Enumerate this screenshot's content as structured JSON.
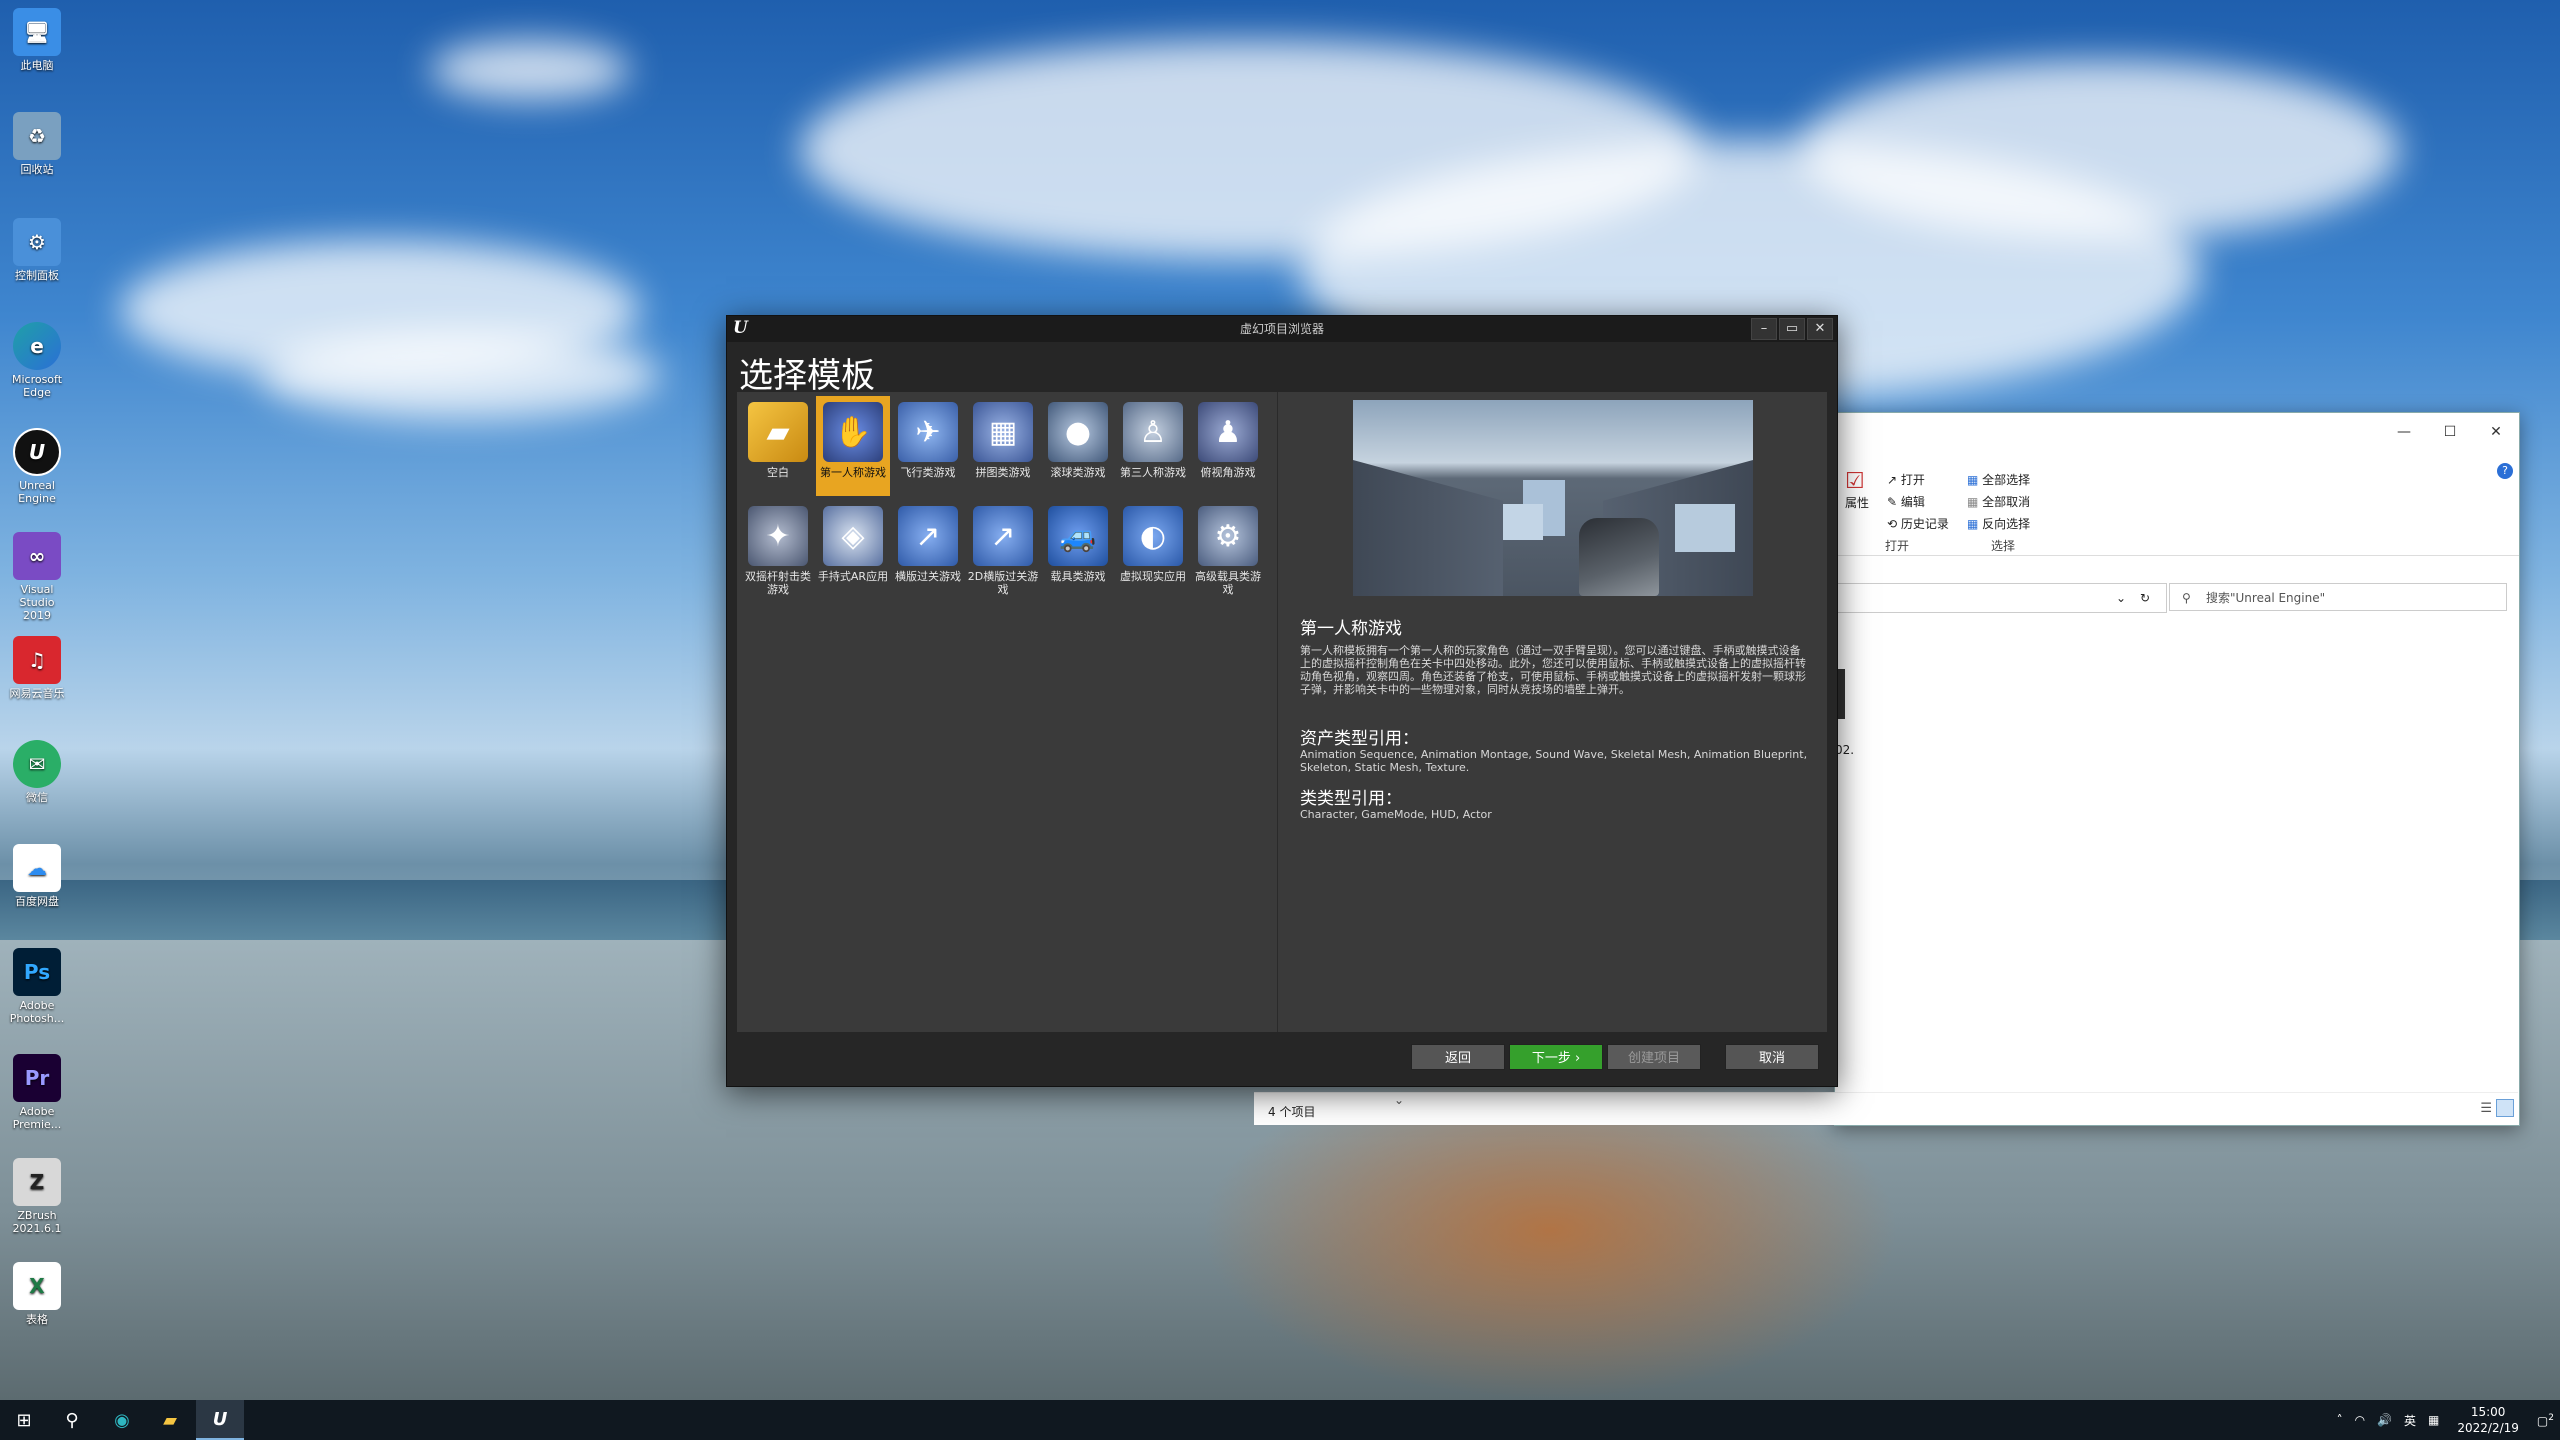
{
  "desktop": {
    "icons": [
      {
        "label": "此电脑",
        "icon": "computer-icon",
        "color": "#3a8ee6"
      },
      {
        "label": "回收站",
        "icon": "recycle-bin-icon",
        "color": "#7aa0c0"
      },
      {
        "label": "控制面板",
        "icon": "control-panel-icon",
        "color": "#4a90d9"
      },
      {
        "label": "Microsoft Edge",
        "icon": "edge-icon",
        "color": "#1fa0a8"
      },
      {
        "label": "Unreal Engine",
        "icon": "unreal-icon",
        "color": "#111111"
      },
      {
        "label": "Visual Studio 2019",
        "icon": "visual-studio-icon",
        "color": "#7a4bc4"
      },
      {
        "label": "网易云音乐",
        "icon": "netease-music-icon",
        "color": "#d9272e"
      },
      {
        "label": "微信",
        "icon": "wechat-icon",
        "color": "#2aae67"
      },
      {
        "label": "百度网盘",
        "icon": "baidu-netdisk-icon",
        "color": "#ffffff"
      },
      {
        "label": "Adobe Photosh...",
        "icon": "photoshop-icon",
        "color": "#001e36"
      },
      {
        "label": "Adobe Premie...",
        "icon": "premiere-icon",
        "color": "#1a0033"
      },
      {
        "label": "ZBrush 2021.6.1",
        "icon": "zbrush-icon",
        "color": "#d8d8d8"
      },
      {
        "label": "表格",
        "icon": "excel-icon",
        "color": "#ffffff"
      }
    ]
  },
  "ue_dialog": {
    "window_title": "虚幻项目浏览器",
    "heading": "选择模板",
    "templates": [
      {
        "label": "空白",
        "icon": "folder-icon",
        "color": "#d9a520"
      },
      {
        "label": "第一人称游戏",
        "icon": "first-person-icon",
        "color": "#4b6fd6",
        "selected": true
      },
      {
        "label": "飞行类游戏",
        "icon": "flying-icon",
        "color": "#5b8fe0"
      },
      {
        "label": "拼图类游戏",
        "icon": "puzzle-icon",
        "color": "#6a8cd8"
      },
      {
        "label": "滚球类游戏",
        "icon": "rolling-ball-icon",
        "color": "#7c9ec4"
      },
      {
        "label": "第三人称游戏",
        "icon": "third-person-icon",
        "color": "#8aa2c2"
      },
      {
        "label": "俯视角游戏",
        "icon": "top-down-icon",
        "color": "#6b7fb0"
      },
      {
        "label": "双摇杆射击类游戏",
        "icon": "twin-stick-icon",
        "color": "#7e8aa6"
      },
      {
        "label": "手持式AR应用",
        "icon": "handheld-ar-icon",
        "color": "#a7b8d6"
      },
      {
        "label": "横版过关游戏",
        "icon": "side-scroller-icon",
        "color": "#5d8fd9"
      },
      {
        "label": "2D横版过关游戏",
        "icon": "2d-side-scroller-icon",
        "color": "#5d8fd9"
      },
      {
        "label": "载具类游戏",
        "icon": "vehicle-icon",
        "color": "#3f7bd4"
      },
      {
        "label": "虚拟现实应用",
        "icon": "vr-icon",
        "color": "#4a84d9"
      },
      {
        "label": "高级载具类游戏",
        "icon": "advanced-vehicle-icon",
        "color": "#8ba4c4"
      }
    ],
    "selected_title": "第一人称游戏",
    "selected_description": "第一人称模板拥有一个第一人称的玩家角色（通过一双手臂呈现）。您可以通过键盘、手柄或触摸式设备上的虚拟摇杆控制角色在关卡中四处移动。此外，您还可以使用鼠标、手柄或触摸式设备上的虚拟摇杆转动角色视角，观察四周。角色还装备了枪支，可使用鼠标、手柄或触摸式设备上的虚拟摇杆发射一颗球形子弹，并影响关卡中的一些物理对象，同时从竞技场的墙壁上弹开。",
    "asset_refs_title": "资产类型引用：",
    "asset_refs": "Animation Sequence, Animation Montage, Sound Wave, Skeletal Mesh, Animation Blueprint, Skeleton, Static Mesh, Texture.",
    "class_refs_title": "类类型引用：",
    "class_refs": "Character, GameMode, HUD, Actor",
    "buttons": {
      "back": "返回",
      "next": "下一步 ›",
      "create": "创建项目",
      "cancel": "取消"
    }
  },
  "explorer": {
    "ribbon": {
      "properties": "属性",
      "open": "打开",
      "edit": "编辑",
      "history": "历史记录",
      "open_group": "打开",
      "select_all": "全部选择",
      "select_none": "全部取消",
      "invert_selection": "反向选择",
      "select_group": "选择"
    },
    "search_placeholder": "搜索\"Unreal Engine\"",
    "side_fragment": "02.",
    "status": "4 个项目"
  },
  "taskbar": {
    "time": "15:00",
    "date": "2022/2/19",
    "ime": "英",
    "notification_count": "2"
  }
}
